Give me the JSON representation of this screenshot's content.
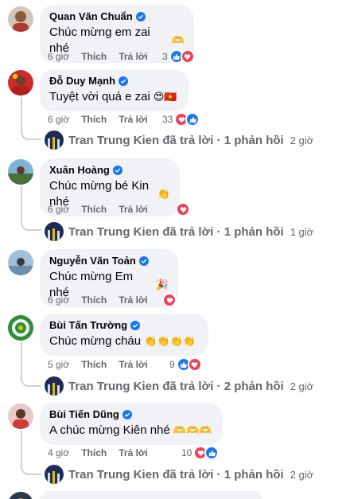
{
  "comments": [
    {
      "author": "Quan Văn Chuẩn",
      "text": "Chúc mừng em zai nhé",
      "emoji": "🫶",
      "time": "6 giờ",
      "like_label": "Thích",
      "reply_label": "Trả lời",
      "reactions_count": "3",
      "reactions": [
        "like-icon",
        "love-icon"
      ]
    },
    {
      "author": "Đỗ Duy Mạnh",
      "text": "Tuyệt vời quá e zai",
      "emoji": "😍🇻🇳",
      "time": "6 giờ",
      "like_label": "Thích",
      "reply_label": "Trả lời",
      "reactions_count": "33",
      "reactions": [
        "love-icon",
        "like-icon"
      ],
      "reply_summary": {
        "text": "Tran Trung Kien đã trả lời · 1 phản hồi",
        "time": "2 giờ"
      }
    },
    {
      "author": "Xuân Hoàng",
      "text": "Chúc mừng bé Kin nhé",
      "emoji": "👏",
      "time": "6 giờ",
      "like_label": "Thích",
      "reply_label": "Trả lời",
      "reactions_count": "",
      "reactions": [
        "love-icon"
      ],
      "reply_summary": {
        "text": "Tran Trung Kien đã trả lời · 1 phản hồi",
        "time": "1 giờ"
      }
    },
    {
      "author": "Nguyễn Văn Toản",
      "text": "Chúc mừng Em nhé",
      "emoji": "🎉",
      "time": "6 giờ",
      "like_label": "Thích",
      "reply_label": "Trả lời",
      "reactions_count": "",
      "reactions": [
        "love-icon"
      ]
    },
    {
      "author": "Bùi Tấn Trường",
      "text": "Chúc mừng cháu",
      "emoji": "👏👏👏👏",
      "time": "5 giờ",
      "like_label": "Thích",
      "reply_label": "Trả lời",
      "reactions_count": "9",
      "reactions": [
        "like-icon",
        "love-icon"
      ],
      "reply_summary": {
        "text": "Tran Trung Kien đã trả lời · 2 phản hồi",
        "time": "2 giờ"
      }
    },
    {
      "author": "Bùi Tiến Dũng",
      "text": "A chúc mừng Kiên nhé",
      "emoji": "🫶🫶🫶",
      "time": "4 giờ",
      "like_label": "Thích",
      "reply_label": "Trả lời",
      "reactions_count": "10",
      "reactions": [
        "love-icon",
        "like-icon"
      ],
      "reply_summary": {
        "text": "Tran Trung Kien đã trả lời · 1 phản hồi",
        "time": "2 giờ"
      }
    }
  ],
  "colors": {
    "bubble": "#f0f2f5",
    "secondary_text": "#65676b",
    "like_blue": "#1877f2",
    "love_red": "#f33e58",
    "connector": "#ced0d4"
  }
}
